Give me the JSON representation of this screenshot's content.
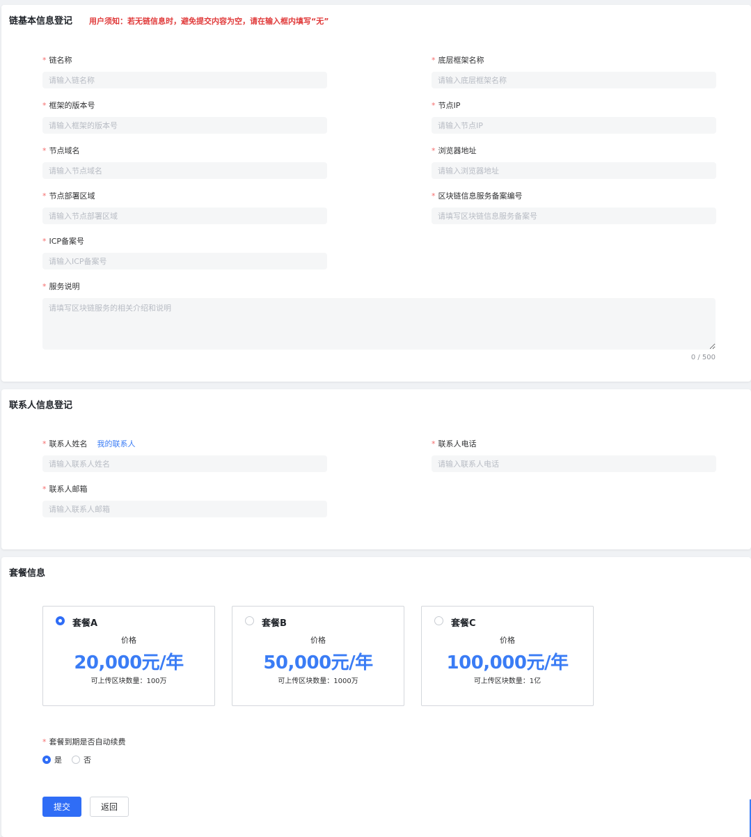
{
  "basic": {
    "title": "链基本信息登记",
    "notice": "用户须知：若无链信息时，避免提交内容为空，请在输入框内填写“无”",
    "fields": [
      {
        "label": "链名称",
        "placeholder": "请输入链名称"
      },
      {
        "label": "底层框架名称",
        "placeholder": "请输入底层框架名称"
      },
      {
        "label": "框架的版本号",
        "placeholder": "请输入框架的版本号"
      },
      {
        "label": "节点IP",
        "placeholder": "请输入节点IP"
      },
      {
        "label": "节点域名",
        "placeholder": "请输入节点域名"
      },
      {
        "label": "浏览器地址",
        "placeholder": "请输入浏览器地址"
      },
      {
        "label": "节点部署区域",
        "placeholder": "请输入节点部署区域"
      },
      {
        "label": "区块链信息服务备案编号",
        "placeholder": "请填写区块链信息服务备案号"
      },
      {
        "label": "ICP备案号",
        "placeholder": "请输入ICP备案号"
      }
    ],
    "service": {
      "label": "服务说明",
      "placeholder": "请填写区块链服务的相关介绍和说明",
      "counter": "0 / 500"
    }
  },
  "contact": {
    "title": "联系人信息登记",
    "name": {
      "label": "联系人姓名",
      "link": "我的联系人",
      "placeholder": "请输入联系人姓名"
    },
    "phone": {
      "label": "联系人电话",
      "placeholder": "请输入联系人电话"
    },
    "email": {
      "label": "联系人邮箱",
      "placeholder": "请输入联系人邮箱"
    }
  },
  "package": {
    "title": "套餐信息",
    "plans": [
      {
        "name": "套餐A",
        "price_label": "价格",
        "price": "20,000元/年",
        "quota": "可上传区块数量：100万",
        "selected": true
      },
      {
        "name": "套餐B",
        "price_label": "价格",
        "price": "50,000元/年",
        "quota": "可上传区块数量：1000万",
        "selected": false
      },
      {
        "name": "套餐C",
        "price_label": "价格",
        "price": "100,000元/年",
        "quota": "可上传区块数量：1亿",
        "selected": false
      }
    ],
    "renew": {
      "label": "套餐到期是否自动续费",
      "options": [
        {
          "label": "是",
          "selected": true
        },
        {
          "label": "否",
          "selected": false
        }
      ]
    },
    "submit_label": "提交",
    "back_label": "返回"
  },
  "required_mark": "*",
  "colors": {
    "primary": "#2f6df6",
    "link": "#3a7cf5",
    "notice": "#e03b3b",
    "required": "#f56c6c"
  }
}
